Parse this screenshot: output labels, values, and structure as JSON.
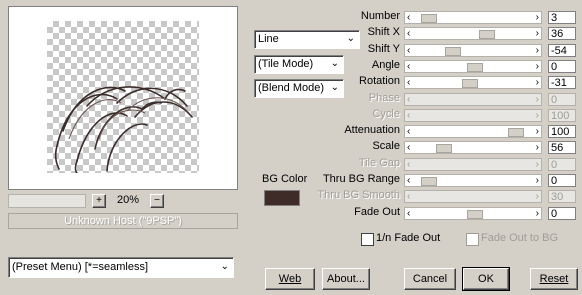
{
  "preview": {
    "zoom_out": "+",
    "zoom_value": "20%",
    "zoom_in": "−",
    "host_label": "Unknown Host (\"9PSP\")"
  },
  "dropdowns": {
    "shape": "Line",
    "tile_mode": "(Tile Mode)",
    "blend_mode": "(Blend Mode)",
    "preset_menu": "(Preset Menu)  [*=seamless]"
  },
  "bg_color": {
    "label": "BG Color",
    "value": "#3f2c29"
  },
  "params": [
    {
      "label": "Number",
      "value": "3",
      "level": 0.05,
      "enabled": true
    },
    {
      "label": "Shift X",
      "value": "36",
      "level": 0.62,
      "enabled": true
    },
    {
      "label": "Shift Y",
      "value": "-54",
      "level": 0.28,
      "enabled": true
    },
    {
      "label": "Angle",
      "value": "0",
      "level": 0.5,
      "enabled": true
    },
    {
      "label": "Rotation",
      "value": "-31",
      "level": 0.45,
      "enabled": true
    },
    {
      "label": "Phase",
      "value": "0",
      "level": 0.5,
      "enabled": false
    },
    {
      "label": "Cycle",
      "value": "100",
      "level": 0.9,
      "enabled": false
    },
    {
      "label": "Attenuation",
      "value": "100",
      "level": 0.9,
      "enabled": true
    },
    {
      "label": "Scale",
      "value": "56",
      "level": 0.2,
      "enabled": true
    },
    {
      "label": "Tile Gap",
      "value": "0",
      "level": 0.5,
      "enabled": false
    },
    {
      "label": "Thru BG Range",
      "value": "0",
      "level": 0.05,
      "enabled": true
    },
    {
      "label": "Thru BG Smooth",
      "value": "30",
      "level": 0.3,
      "enabled": false
    },
    {
      "label": "Fade Out",
      "value": "0",
      "level": 0.5,
      "enabled": true
    }
  ],
  "checkboxes": {
    "fade_out_inv": "1/n Fade Out",
    "fade_out_bg": "Fade Out to BG"
  },
  "buttons": {
    "web": "Web",
    "about": "About...",
    "cancel": "Cancel",
    "ok": "OK",
    "reset": "Reset"
  }
}
